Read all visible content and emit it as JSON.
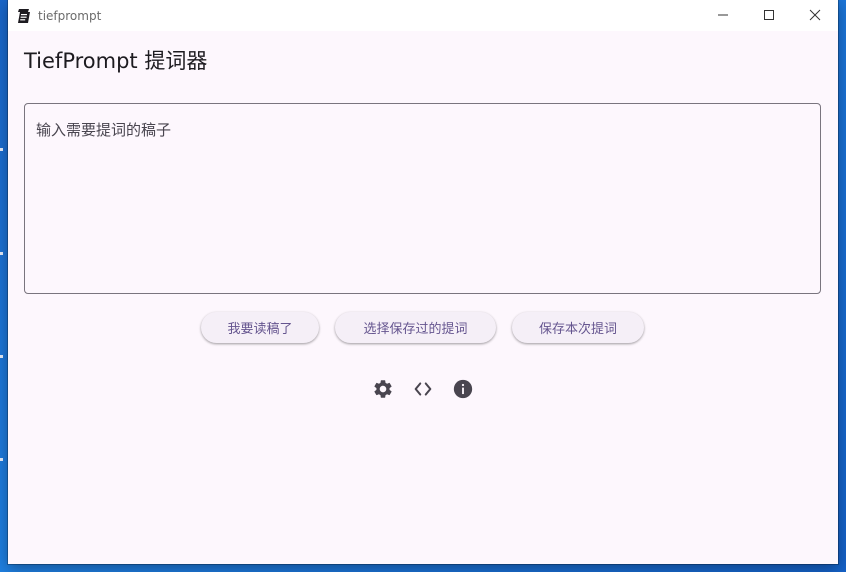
{
  "window": {
    "title": "tiefprompt",
    "controls": [
      "minimize-icon",
      "maximize-icon",
      "close-icon"
    ]
  },
  "main": {
    "heading": "TiefPrompt 提词器",
    "draft_input": {
      "value": "",
      "placeholder": "输入需要提词的稿子"
    },
    "actions": {
      "start_reading": "我要读稿了",
      "choose_saved": "选择保存过的提词",
      "save_current": "保存本次提词"
    },
    "footer_icons": [
      "settings-icon",
      "code-icon",
      "info-icon"
    ]
  },
  "colors": {
    "window_bg": "#fdf7fd",
    "button_bg": "#f5eff7",
    "button_text": "#65558f",
    "icon": "#49454f",
    "outline": "#79747e",
    "desktop": "#1f7fe0"
  }
}
